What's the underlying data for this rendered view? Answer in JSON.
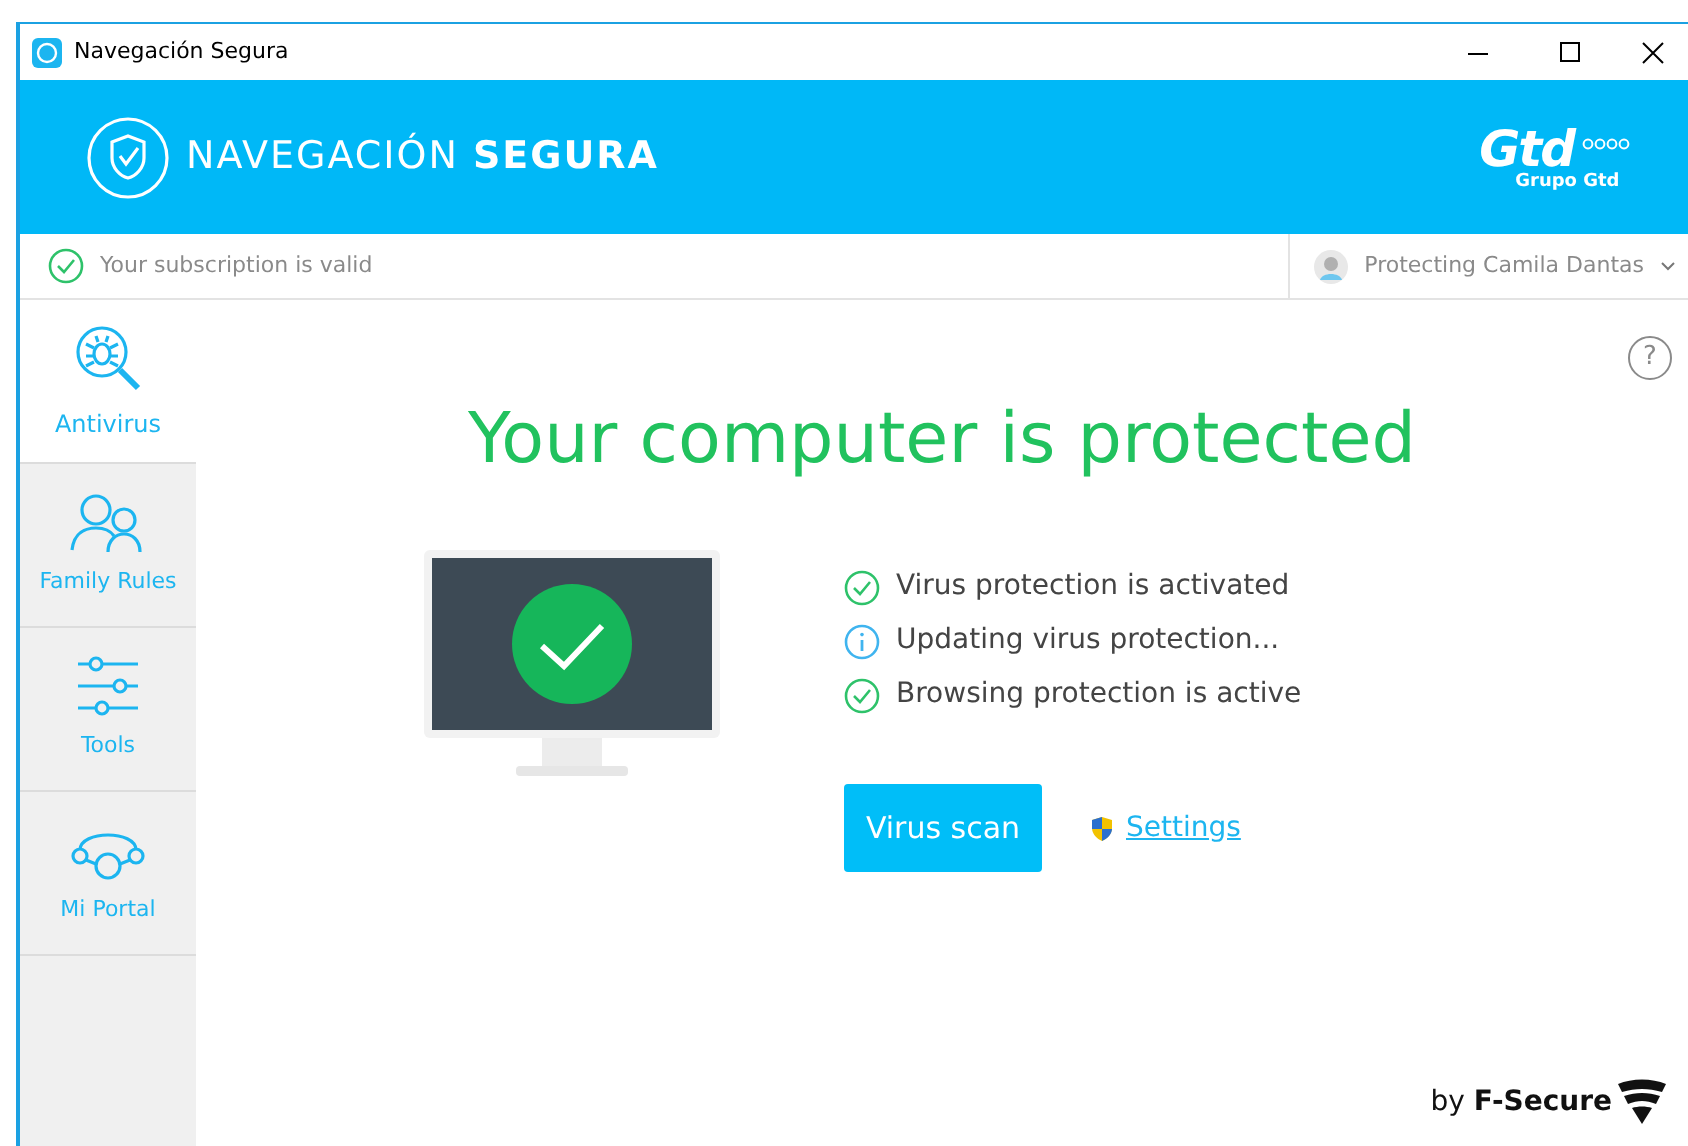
{
  "window": {
    "title": "Navegación Segura"
  },
  "header": {
    "product": "NAVEGACIÓN **SEGURA**",
    "brand": "Gtd",
    "brand_sub": "Grupo Gtd"
  },
  "subscription": {
    "text": "Your subscription is valid",
    "account": "Protecting Camila Dantas"
  },
  "sidebar": {
    "items": [
      {
        "label": "Antivirus",
        "kind": "bug",
        "selected": true
      },
      {
        "label": "Family Rules",
        "kind": "family",
        "selected": false
      },
      {
        "label": "Tools",
        "kind": "sliders",
        "selected": false
      },
      {
        "label": "Mi Portal",
        "kind": "portal",
        "selected": false
      }
    ]
  },
  "main": {
    "help": "?",
    "headline": "Your computer is protected",
    "statuses": [
      {
        "kind": "ok",
        "text": "Virus protection is activated"
      },
      {
        "kind": "info",
        "text": "Updating virus protection..."
      },
      {
        "kind": "ok",
        "text": "Browsing protection is active"
      }
    ],
    "scan_button": "Virus scan",
    "settings_link": "Settings"
  },
  "footer": {
    "vendor": "by **F-Secure**"
  }
}
